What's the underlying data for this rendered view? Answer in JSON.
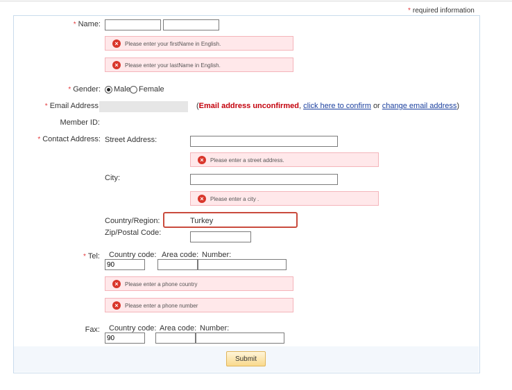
{
  "required_info": {
    "star": "*",
    "text": "required information"
  },
  "name": {
    "label": "Name:",
    "first_value": "",
    "last_value": "",
    "error_first": "Please enter your firstName in English.",
    "error_last": "Please enter your lastName in English."
  },
  "gender": {
    "label": "Gender:",
    "options": [
      {
        "label": "Male",
        "checked": true
      },
      {
        "label": "Female",
        "checked": false
      }
    ]
  },
  "email": {
    "label": "Email Address",
    "status": "Email address unconfirmed",
    "sep1": ",",
    "confirm_link": "click here to confirm",
    "or": "or",
    "change_link": "change email address",
    "open_paren": "(",
    "close_paren": ")"
  },
  "member_id": {
    "label": "Member ID:"
  },
  "contact": {
    "label": "Contact Address:",
    "street_label": "Street Address:",
    "street_value": "",
    "street_error": "Please enter a street address.",
    "city_label": "City:",
    "city_value": "",
    "city_error": "Please enter a city .",
    "country_label": "Country/Region:",
    "country_value": "Turkey",
    "zip_label": "Zip/Postal Code:",
    "zip_value": ""
  },
  "tel": {
    "label": "Tel:",
    "country_code_label": "Country code:",
    "area_code_label": "Area code:",
    "number_label": "Number:",
    "country_code_value": "90",
    "area_code_value": "",
    "number_value": "",
    "error_country": "Please enter a phone country",
    "error_number": "Please enter a phone number"
  },
  "fax": {
    "label": "Fax:",
    "country_code_label": "Country code:",
    "area_code_label": "Area code:",
    "number_label": "Number:",
    "country_code_value": "90",
    "area_code_value": "",
    "number_value": ""
  },
  "submit_label": "Submit",
  "error_icon_glyph": "×",
  "colors": {
    "required_star": "#e4393c",
    "error_bg": "#ffe8ea",
    "error_border": "#f4b4ba",
    "highlight_border": "#c94a3c",
    "link": "#1a3f9e"
  }
}
